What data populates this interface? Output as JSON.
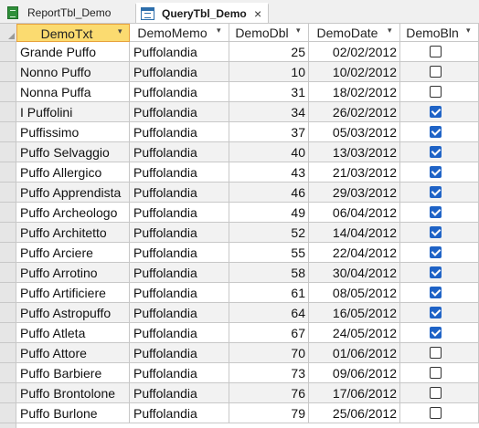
{
  "tabs": [
    {
      "label": "ReportTbl_Demo",
      "icon": "report-icon",
      "active": false
    },
    {
      "label": "QueryTbl_Demo",
      "icon": "query-icon",
      "active": true
    }
  ],
  "close_glyph": "×",
  "columns": [
    {
      "key": "DemoTxt",
      "label": "DemoTxt",
      "sorted": true
    },
    {
      "key": "DemoMemo",
      "label": "DemoMemo",
      "sorted": false
    },
    {
      "key": "DemoDbl",
      "label": "DemoDbl",
      "sorted": false
    },
    {
      "key": "DemoDate",
      "label": "DemoDate",
      "sorted": false
    },
    {
      "key": "DemoBln",
      "label": "DemoBln",
      "sorted": false
    }
  ],
  "dropdown_glyph": "▾",
  "rows": [
    {
      "txt": "Grande Puffo",
      "memo": "Puffolandia",
      "dbl": "25",
      "date": "02/02/2012",
      "bln": false
    },
    {
      "txt": "Nonno Puffo",
      "memo": "Puffolandia",
      "dbl": "10",
      "date": "10/02/2012",
      "bln": false
    },
    {
      "txt": "Nonna Puffa",
      "memo": "Puffolandia",
      "dbl": "31",
      "date": "18/02/2012",
      "bln": false
    },
    {
      "txt": "I Puffolini",
      "memo": "Puffolandia",
      "dbl": "34",
      "date": "26/02/2012",
      "bln": true
    },
    {
      "txt": "Puffissimo",
      "memo": "Puffolandia",
      "dbl": "37",
      "date": "05/03/2012",
      "bln": true
    },
    {
      "txt": "Puffo Selvaggio",
      "memo": "Puffolandia",
      "dbl": "40",
      "date": "13/03/2012",
      "bln": true
    },
    {
      "txt": "Puffo Allergico",
      "memo": "Puffolandia",
      "dbl": "43",
      "date": "21/03/2012",
      "bln": true
    },
    {
      "txt": "Puffo Apprendista",
      "memo": "Puffolandia",
      "dbl": "46",
      "date": "29/03/2012",
      "bln": true
    },
    {
      "txt": "Puffo Archeologo",
      "memo": "Puffolandia",
      "dbl": "49",
      "date": "06/04/2012",
      "bln": true
    },
    {
      "txt": "Puffo Architetto",
      "memo": "Puffolandia",
      "dbl": "52",
      "date": "14/04/2012",
      "bln": true
    },
    {
      "txt": "Puffo Arciere",
      "memo": "Puffolandia",
      "dbl": "55",
      "date": "22/04/2012",
      "bln": true
    },
    {
      "txt": "Puffo Arrotino",
      "memo": "Puffolandia",
      "dbl": "58",
      "date": "30/04/2012",
      "bln": true
    },
    {
      "txt": "Puffo Artificiere",
      "memo": "Puffolandia",
      "dbl": "61",
      "date": "08/05/2012",
      "bln": true
    },
    {
      "txt": "Puffo Astropuffo",
      "memo": "Puffolandia",
      "dbl": "64",
      "date": "16/05/2012",
      "bln": true
    },
    {
      "txt": "Puffo Atleta",
      "memo": "Puffolandia",
      "dbl": "67",
      "date": "24/05/2012",
      "bln": true
    },
    {
      "txt": "Puffo Attore",
      "memo": "Puffolandia",
      "dbl": "70",
      "date": "01/06/2012",
      "bln": false
    },
    {
      "txt": "Puffo Barbiere",
      "memo": "Puffolandia",
      "dbl": "73",
      "date": "09/06/2012",
      "bln": false
    },
    {
      "txt": "Puffo Brontolone",
      "memo": "Puffolandia",
      "dbl": "76",
      "date": "17/06/2012",
      "bln": false
    },
    {
      "txt": "Puffo Burlone",
      "memo": "Puffolandia",
      "dbl": "79",
      "date": "25/06/2012",
      "bln": false
    }
  ],
  "colors": {
    "sorted_header_bg": "#fbdb70",
    "checkbox_checked": "#1f63c6",
    "gridline": "#c8c8c8",
    "alt_row": "#f2f2f2"
  }
}
